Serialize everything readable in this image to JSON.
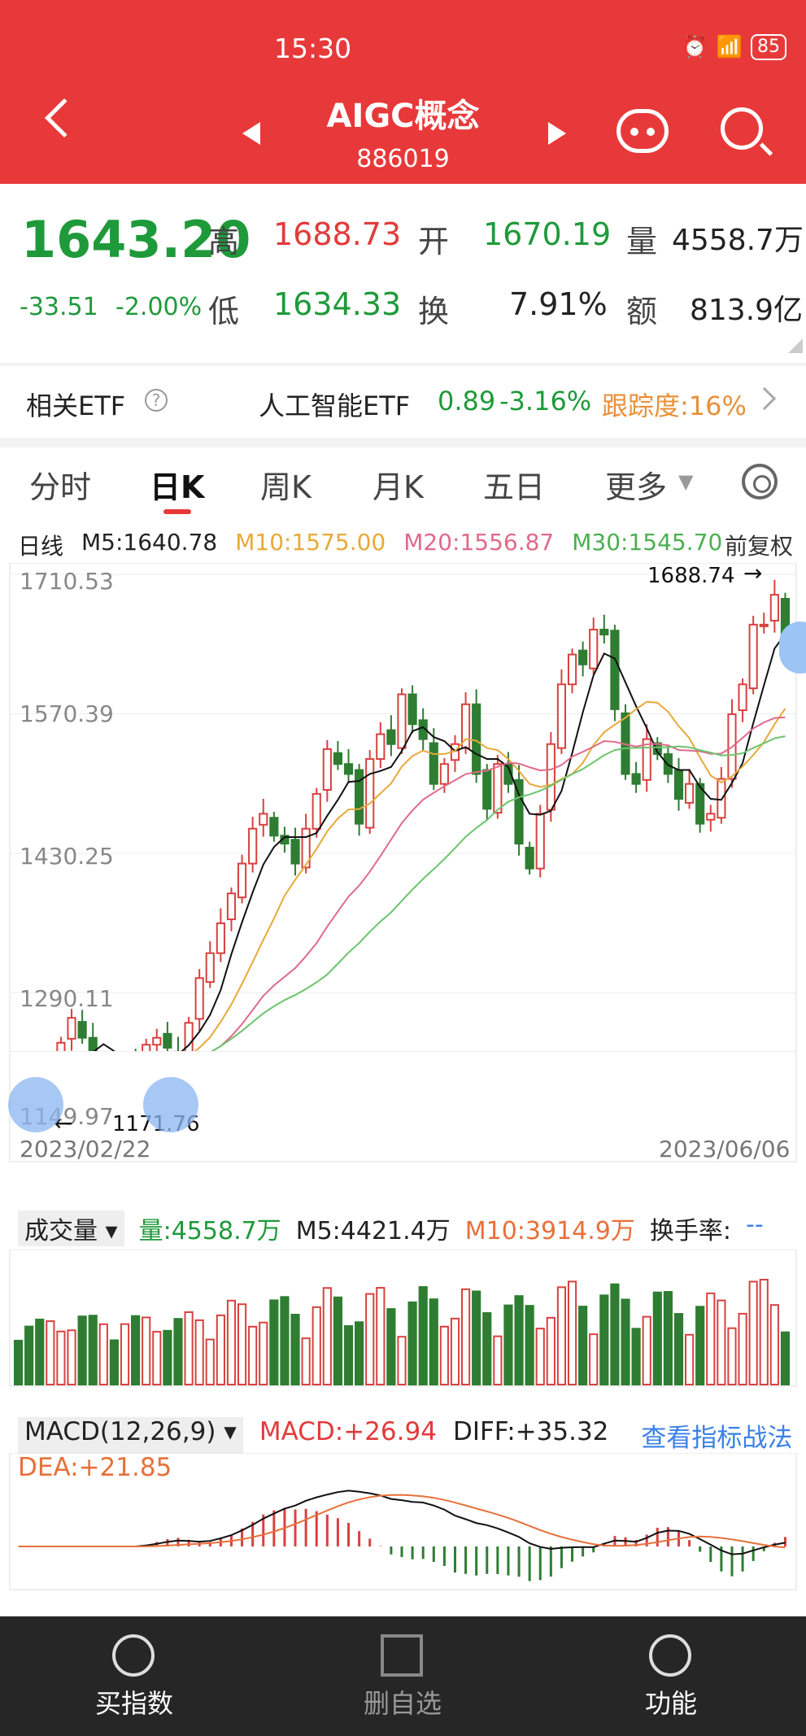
{
  "status": {
    "time": "15:30",
    "battery": "85"
  },
  "header": {
    "title": "AIGC概念",
    "code": "886019"
  },
  "quote": {
    "price": "1643.20",
    "change": "-33.51",
    "change_pct": "-2.00%",
    "high_label": "高",
    "high": "1688.73",
    "open_label": "开",
    "open": "1670.19",
    "vol_label": "量",
    "vol": "4558.7万",
    "low_label": "低",
    "low": "1634.33",
    "turn_label": "换",
    "turn": "7.91%",
    "amt_label": "额",
    "amt": "813.9亿"
  },
  "etf": {
    "label": "相关ETF",
    "name": "人工智能ETF",
    "price": "0.89",
    "pct": "-3.16%",
    "track": "跟踪度:16%"
  },
  "tabs": [
    "分时",
    "日K",
    "周K",
    "月K",
    "五日",
    "更多"
  ],
  "kline": {
    "period": "日线",
    "m5": "M5:1640.78",
    "m10": "M10:1575.00",
    "m20": "M20:1556.87",
    "m30": "M30:1545.70",
    "adjust": "前复权",
    "yticks": [
      "1710.53",
      "1570.39",
      "1430.25",
      "1290.11",
      "1149.97"
    ],
    "max_label": "1688.74",
    "min_label": "1171.76",
    "date_start": "2023/02/22",
    "date_end": "2023/06/06"
  },
  "volume": {
    "title": "成交量",
    "vol": "量:4558.7万",
    "m5": "M5:4421.4万",
    "m10": "M10:3914.9万",
    "turnover": "换手率:",
    "turnover_val": "--"
  },
  "macd": {
    "title": "MACD(12,26,9)",
    "macd": "MACD:+26.94",
    "diff": "DIFF:+35.32",
    "link": "查看指标战法",
    "dea": "DEA:+21.85"
  },
  "bottom": [
    "买指数",
    "删自选",
    "功能"
  ],
  "chart_data": {
    "type": "candlestick",
    "y_range": [
      1149.97,
      1710.53
    ],
    "close": [
      1190,
      1178,
      1172,
      1185,
      1240,
      1265,
      1245,
      1218,
      1225,
      1205,
      1215,
      1212,
      1238,
      1245,
      1235,
      1210,
      1260,
      1305,
      1330,
      1360,
      1390,
      1420,
      1455,
      1470,
      1448,
      1440,
      1420,
      1455,
      1490,
      1535,
      1520,
      1510,
      1460,
      1525,
      1550,
      1540,
      1590,
      1560,
      1545,
      1500,
      1520,
      1540,
      1580,
      1510,
      1475,
      1520,
      1500,
      1440,
      1415,
      1470,
      1540,
      1600,
      1630,
      1620,
      1655,
      1650,
      1575,
      1510,
      1500,
      1545,
      1530,
      1510,
      1485,
      1500,
      1460,
      1470,
      1505,
      1570,
      1600,
      1660,
      1660,
      1690,
      1643
    ],
    "ma_colors": {
      "m5": "#111111",
      "m10": "#e8a93a",
      "m20": "#e06a8a",
      "m30": "#6cc46c"
    }
  },
  "colors": {
    "up": "#d94040",
    "down": "#2e7d32",
    "accent": "#e8393a"
  }
}
